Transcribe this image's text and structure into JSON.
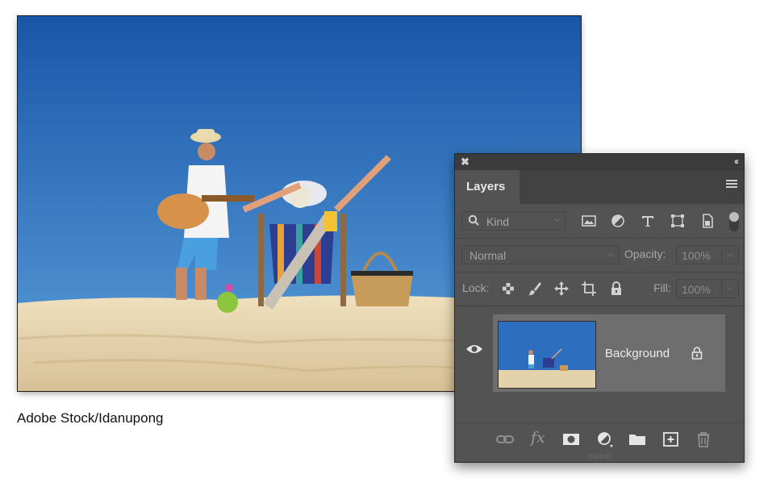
{
  "caption": "Adobe Stock/Idanupong",
  "photo": {
    "subject": "beach-scene",
    "colors": {
      "sky_top": "#1d5fb3",
      "sky_bottom": "#4f97d6",
      "sand": "#e6d3ad"
    }
  },
  "panel": {
    "close_glyph": "✖",
    "collapse_glyph": "‹‹",
    "tab_label": "Layers",
    "filter": {
      "kind_label": "Kind",
      "icons": [
        "image-filter-icon",
        "adjustment-filter-icon",
        "type-filter-icon",
        "shape-filter-icon",
        "smart-object-filter-icon"
      ]
    },
    "blend_mode": "Normal",
    "opacity_label": "Opacity:",
    "opacity_value": "100%",
    "lock_label": "Lock:",
    "fill_label": "Fill:",
    "fill_value": "100%",
    "layers": [
      {
        "name": "Background",
        "visible": true,
        "locked": true
      }
    ],
    "bottom_icons": [
      "link-layers-icon",
      "fx-icon",
      "layer-mask-icon",
      "adjustment-layer-icon",
      "group-folder-icon",
      "new-layer-icon",
      "trash-icon"
    ],
    "fx_label": "fx",
    "colors": {
      "panel_bg": "#535353",
      "title_bg": "#3b3b3b",
      "selected_row": "#6e6e6e"
    }
  }
}
